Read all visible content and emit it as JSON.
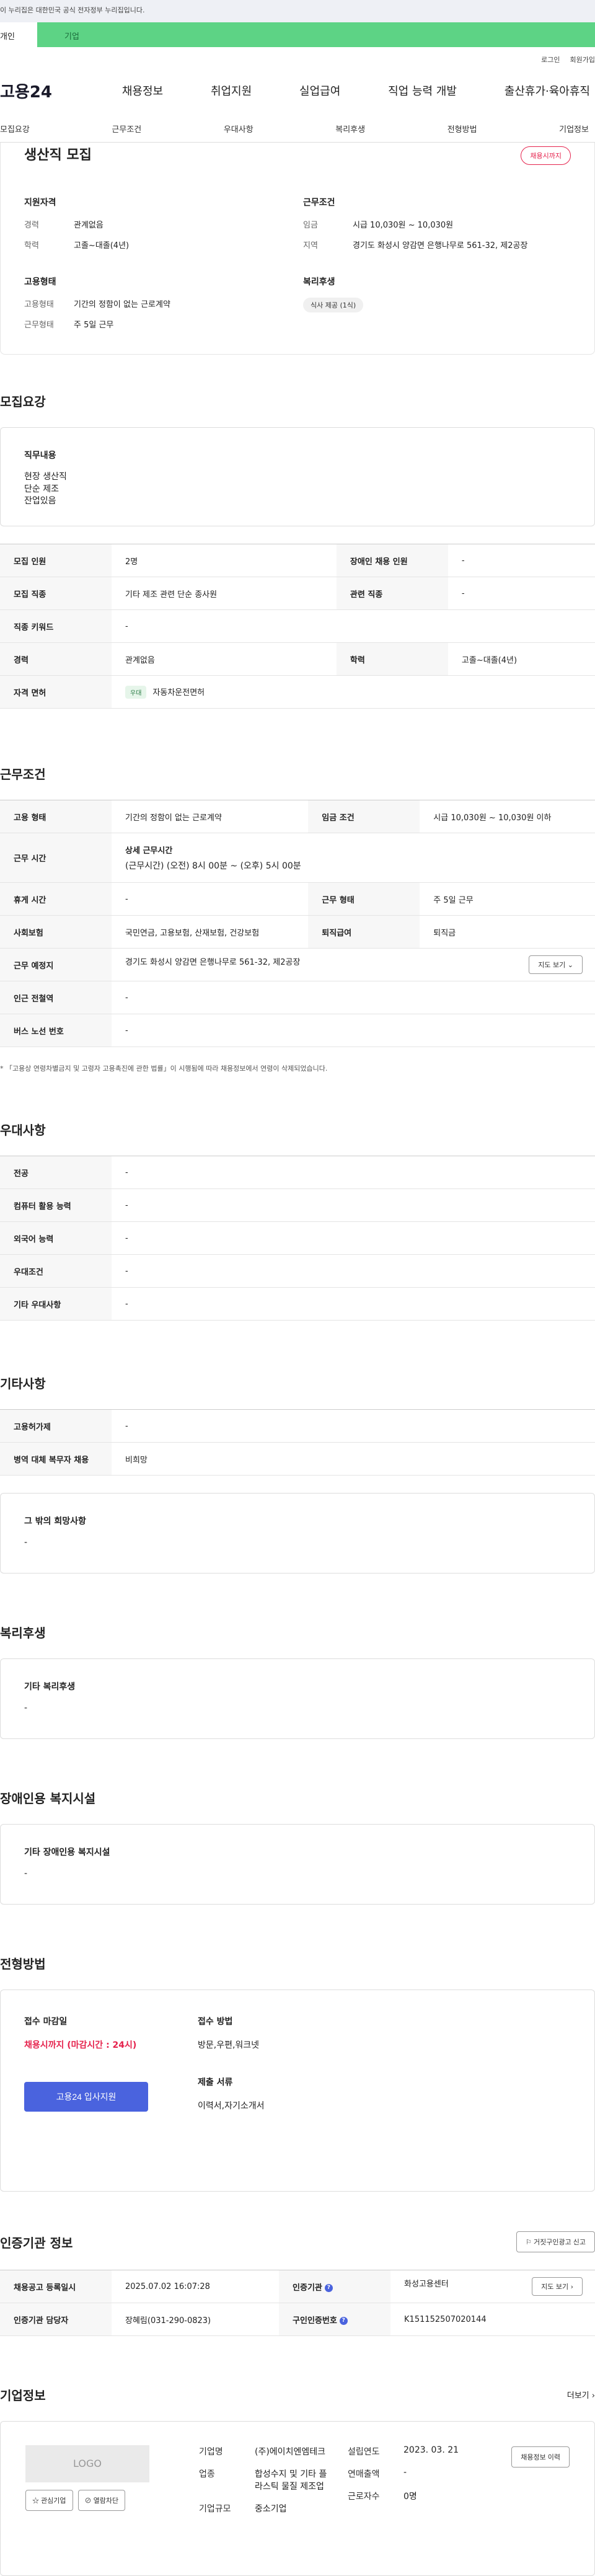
{
  "gov_banner": "이 누리집은 대한민국 공식 전자정부 누리집입니다.",
  "tabs": [
    "개인",
    "기업"
  ],
  "util": [
    "로그인",
    "회원가입"
  ],
  "gnb": {
    "logo": "고용24",
    "menu": [
      "채용정보",
      "취업지원",
      "실업급여",
      "직업 능력 개발",
      "출산휴가·육아휴직"
    ]
  },
  "subnav": [
    "모집요강",
    "근무조건",
    "우대사항",
    "복리후생",
    "전형방법",
    "기업정보"
  ],
  "summary": {
    "title": "생산직 모집",
    "badge": "채용시까지",
    "qual_h": "지원자격",
    "qual": [
      [
        "경력",
        "관계없음"
      ],
      [
        "학력",
        "고졸~대졸(4년)"
      ]
    ],
    "emp_h": "고용형태",
    "emp": [
      [
        "고용형태",
        "기간의 정함이 없는 근로계약"
      ],
      [
        "근무형태",
        "주 5일 근무"
      ]
    ],
    "cond_h": "근무조건",
    "cond": [
      [
        "임금",
        "시급 10,030원 ~ 10,030원"
      ],
      [
        "지역",
        "경기도 화성시 양감면 은행나무로 561-32, 제2공장"
      ]
    ],
    "welfare_h": "복리후생",
    "welfare_chip": "식사 제공 (1식)"
  },
  "recruit": {
    "title": "모집요강",
    "duty_h": "직무내용",
    "duty_lines": [
      "현장 생산직",
      "단순 제조",
      "잔업있음"
    ],
    "rows": [
      [
        "모집 인원",
        "2명",
        "장애인 채용 인원",
        "-"
      ],
      [
        "모집 직종",
        "기타 제조 관련 단순 종사원",
        "관련 직종",
        "-"
      ],
      [
        "직종 키워드",
        "-"
      ],
      [
        "경력",
        "관계없음",
        "학력",
        "고졸~대졸(4년)"
      ],
      [
        "자격 면허",
        "우대",
        "자동차운전면허"
      ]
    ]
  },
  "work": {
    "title": "근무조건",
    "rows": [
      [
        "고용 형태",
        "기간의 정함이 없는 근로계약",
        "임금 조건",
        "시급 10,030원 ~ 10,030원 이하"
      ],
      [
        "근무 시간",
        "상세 근무시간",
        "(근무시간) (오전) 8시 00분 ~ (오후) 5시 00분"
      ],
      [
        "휴게 시간",
        "-",
        "근무 형태",
        "주 5일 근무"
      ],
      [
        "사회보험",
        "국민연금, 고용보험, 산재보험, 건강보험",
        "퇴직급여",
        "퇴직금"
      ],
      [
        "근무 예정지",
        "경기도 화성시 양감면 은행나무로 561-32, 제2공장",
        "지도 보기"
      ],
      [
        "인근 전철역",
        "-"
      ],
      [
        "버스 노선 번호",
        "-"
      ]
    ],
    "note": "* 「고용상 연령차별금지 및 고령자 고용촉진에 관한 법률」이 시행됨에 따라 채용정보에서 연령이 삭제되었습니다."
  },
  "pref": {
    "title": "우대사항",
    "rows": [
      [
        "전공",
        "-"
      ],
      [
        "컴퓨터 활용 능력",
        "-"
      ],
      [
        "외국어 능력",
        "-"
      ],
      [
        "우대조건",
        "-"
      ],
      [
        "기타 우대사항",
        "-"
      ]
    ]
  },
  "etc": {
    "title": "기타사항",
    "rows": [
      [
        "고용허가제",
        "-"
      ],
      [
        "병역 대체 복무자 채용",
        "비희망"
      ]
    ],
    "other_h": "그 밖의 희망사항",
    "other_v": "-"
  },
  "welfare": {
    "title": "복리후생",
    "h": "기타 복리후생",
    "v": "-"
  },
  "disabled": {
    "title": "장애인용 복지시설",
    "h": "기타 장애인용 복지시설",
    "v": "-"
  },
  "selection": {
    "title": "전형방법",
    "deadline_h": "접수 마감일",
    "deadline_v": "채용시까지 (마감시간 : 24시)",
    "apply_btn": "고용24 입사지원",
    "method_h": "접수 방법",
    "method_v": "방문,우편,워크넷",
    "docs_h": "제출 서류",
    "docs_v": "이력서,자기소개서"
  },
  "agency": {
    "title": "인증기관 정보",
    "report": "거짓구인광고 신고",
    "r1": [
      "채용공고 등록일시",
      "2025.07.02 16:07:28",
      "인증기관",
      "화성고용센터",
      "지도 보기"
    ],
    "r2": [
      "인증기관 담당자",
      "장혜림(031-290-0823)",
      "구인인증번호",
      "K151152507020144"
    ]
  },
  "company": {
    "title": "기업정보",
    "more": "더보기",
    "logo": "LOGO",
    "fav": "관심기업",
    "block": "열람차단",
    "f1": [
      [
        "기업명",
        "(주)에이치엔엠테크"
      ],
      [
        "업종",
        "합성수지 및 기타 플라스틱 물질 제조업"
      ],
      [
        "기업규모",
        "중소기업"
      ]
    ],
    "f2": [
      [
        "설립연도",
        "2023. 03. 21"
      ],
      [
        "연매출액",
        "-"
      ],
      [
        "근로자수",
        "0명"
      ]
    ],
    "history": "채용정보 이력"
  }
}
